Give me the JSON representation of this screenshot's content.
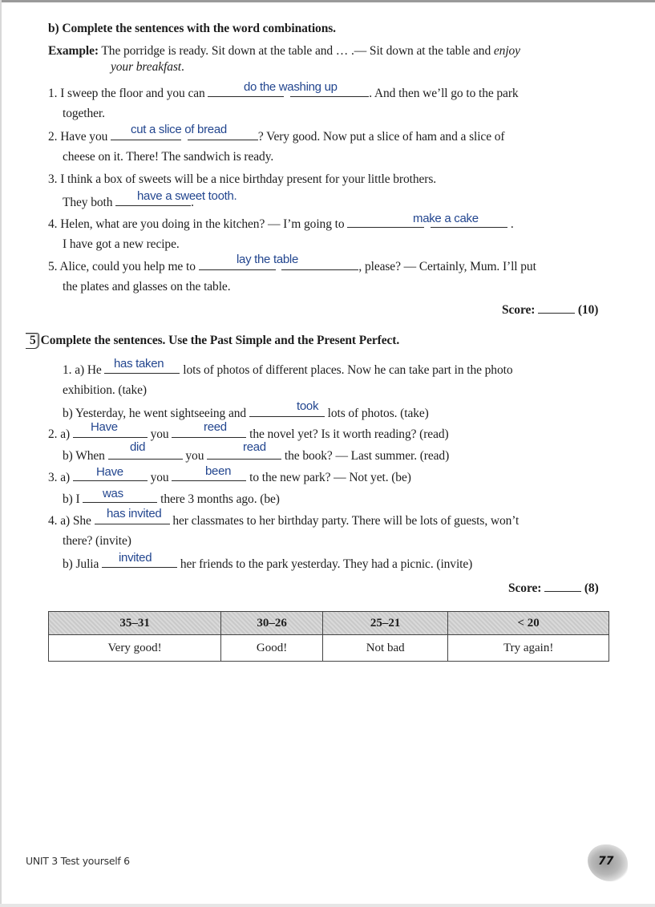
{
  "section_b": {
    "heading": "b) Complete the sentences with the word combinations.",
    "example_label": "Example:",
    "example_text": "The porridge is ready. Sit down at the table and … .— Sit down at the table and",
    "example_italic_1": "enjoy",
    "example_italic_2": "your breakfast",
    "example_end": ".",
    "items": [
      {
        "num": "1.",
        "before": "I sweep the floor and you can",
        "answer": "do the washing up",
        "after": ". And then we’ll go to the park",
        "cont": "together."
      },
      {
        "num": "2.",
        "before": "Have you",
        "answer": "cut a slice of bread",
        "after": "? Very good. Now put a slice of ham and a slice of",
        "cont": "cheese on it. There! The sandwich is ready."
      },
      {
        "num": "3.",
        "before": "I think a box of sweets will be a nice birthday present for your little brothers.",
        "cont_before": "They both",
        "answer": "have a sweet tooth.",
        "after": "."
      },
      {
        "num": "4.",
        "before": "Helen, what are you doing in the kitchen? — I’m going to",
        "answer": "make a cake",
        "after": ".",
        "cont": "I have got a new recipe."
      },
      {
        "num": "5.",
        "before": "Alice, could you help me to",
        "answer": "lay the table",
        "after": ", please? — Certainly, Mum. I’ll put",
        "cont": "the plates and glasses on the table."
      }
    ],
    "score_label": "Score:",
    "score_max": "(10)"
  },
  "exercise5": {
    "number": "5",
    "heading": "Complete the sentences. Use the Past Simple and the Present Perfect.",
    "items": {
      "1a": {
        "num": "1. a)",
        "before": "He",
        "answer": "has taken",
        "after": "lots of photos of different places. Now he can take part in the photo",
        "cont": "exhibition. (take)"
      },
      "1b": {
        "num": "b)",
        "before": "Yesterday, he went sightseeing and",
        "answer": "took",
        "after": "lots of photos. (take)"
      },
      "2a": {
        "num": "2. a)",
        "answer1": "Have",
        "mid": "you",
        "answer2": "reed",
        "after": "the novel yet? Is it worth reading? (read)"
      },
      "2b": {
        "num": "b)",
        "before": "When",
        "answer1": "did",
        "mid": "you",
        "answer2": "read",
        "after": "the book? — Last summer. (read)"
      },
      "3a": {
        "num": "3. a)",
        "answer1": "Have",
        "mid": "you",
        "answer2": "been",
        "after": "to the new park? — Not yet. (be)"
      },
      "3b": {
        "num": "b)",
        "before": "I",
        "answer": "was",
        "after": "there 3 months ago. (be)"
      },
      "4a": {
        "num": "4. a)",
        "before": "She",
        "answer": "has invited",
        "after": "her classmates to her birthday party. There will be lots of guests, won’t",
        "cont": "there? (invite)"
      },
      "4b": {
        "num": "b)",
        "before": "Julia",
        "answer": "invited",
        "after": "her friends to the park yesterday. They had a picnic. (invite)"
      }
    },
    "score_label": "Score:",
    "score_max": "(8)"
  },
  "score_table": {
    "ranges": [
      "35–31",
      "30–26",
      "25–21",
      "< 20"
    ],
    "labels": [
      "Very good!",
      "Good!",
      "Not bad",
      "Try again!"
    ]
  },
  "footer": {
    "unit": "UNIT 3  Test yourself 6",
    "page_number": "77"
  }
}
